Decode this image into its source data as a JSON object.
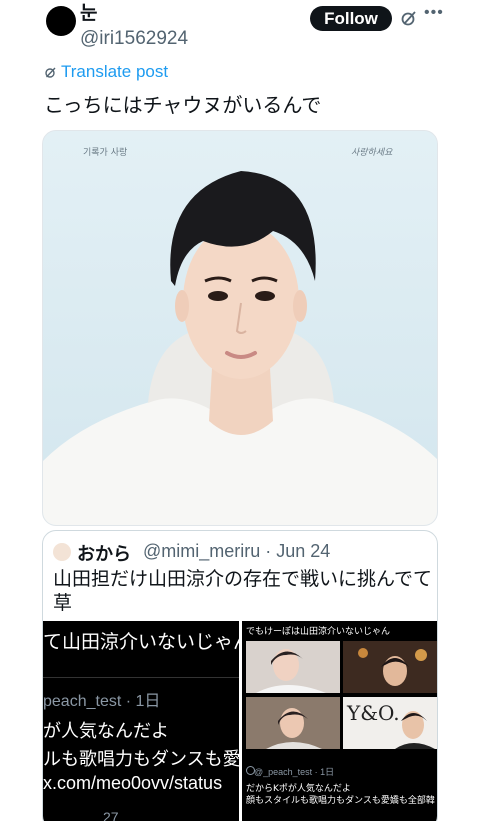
{
  "post": {
    "display_name": "눈",
    "handle": "@iri1562924",
    "follow_label": "Follow",
    "translate_label": "Translate post",
    "text": "こっちにはチャウヌがいるんで",
    "image_signatures": {
      "left": "기록가 사랑",
      "right": "사랑하세요"
    }
  },
  "quote": {
    "name": "おから",
    "handle_date": "@mimi_meriru · Jun 24",
    "text": "山田担だけ山田涼介の存在で戦いに挑んでて草",
    "media_left": {
      "line1": "て山田涼介いないじゃん",
      "line2": "peach_test · 1日",
      "line3": "が人気なんだよ",
      "line4": "ルも歌唱力もダンスも愛",
      "line5": "x.com/meo0ovv/status",
      "line6": "27"
    },
    "media_right": {
      "header": "でもけーぽは山田涼介いないじゃん",
      "photo_text": "Y&O.",
      "meta": "@_peach_test · 1日",
      "body1": "だからKポが人気なんだよ",
      "body2": "顔もスタイルも歌唱力もダンスも愛嬌も全部韓"
    }
  },
  "colors": {
    "accent": "#1d9bf0",
    "text": "#0f1419",
    "muted": "#536471"
  }
}
